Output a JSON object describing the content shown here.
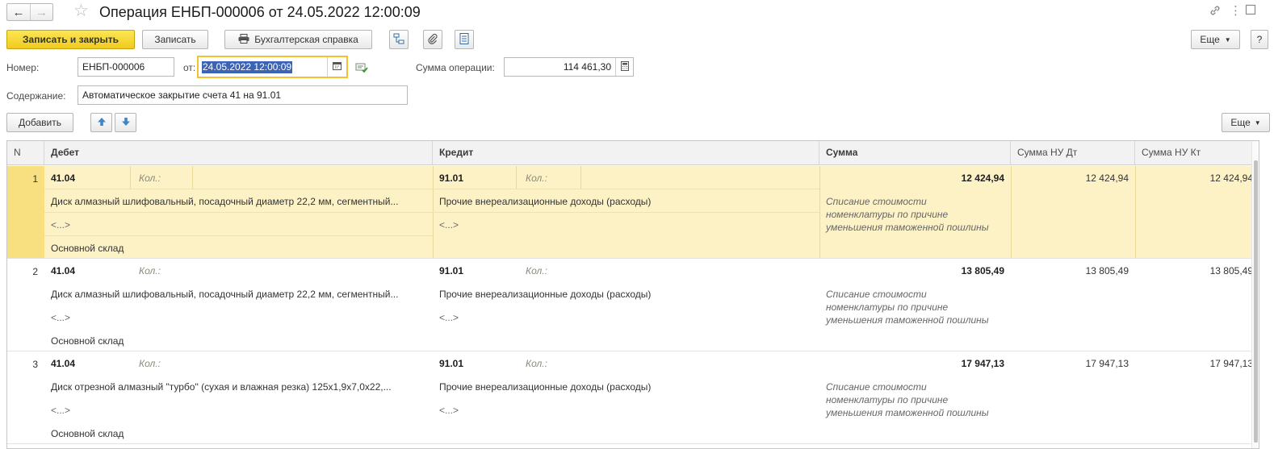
{
  "header": {
    "back_icon": "arrow-left-icon",
    "forward_icon": "arrow-right-icon",
    "title": "Операция ЕНБП-000006 от 24.05.2022 12:00:09",
    "help_label": "?"
  },
  "toolbar": {
    "save_close_label": "Записать и закрыть",
    "save_label": "Записать",
    "report_label": "Бухгалтерская справка",
    "more_label": "Еще"
  },
  "form": {
    "number_label": "Номер:",
    "number_value": "ЕНБП-000006",
    "date_label": "от:",
    "date_value": "24.05.2022 12:00:09",
    "sum_label": "Сумма операции:",
    "sum_value": "114 461,30",
    "content_label": "Содержание:",
    "content_value": "Автоматическое закрытие счета 41 на 91.01"
  },
  "table_toolbar": {
    "add_label": "Добавить",
    "more_label": "Еще"
  },
  "table": {
    "columns": [
      "N",
      "Дебет",
      "Кредит",
      "Сумма",
      "Сумма НУ Дт",
      "Сумма НУ Кт"
    ],
    "kol_label": "Кол.:",
    "rows": [
      {
        "n": "1",
        "debit_account": "41.04",
        "debit_item": "Диск алмазный шлифовальный, посадочный диаметр 22,2 мм, сегментный...",
        "debit_sub2": "<...>",
        "debit_sub3": "Основной склад",
        "credit_account": "91.01",
        "credit_item": "Прочие внереализационные доходы (расходы)",
        "credit_sub2": "<...>",
        "sum": "12 424,94",
        "comment_1": "Списание стоимости",
        "comment_2": "номенклатуры по причине",
        "comment_3": "уменьшения таможенной пошлины",
        "sum_nu_dt": "12 424,94",
        "sum_nu_kt": "12 424,94"
      },
      {
        "n": "2",
        "debit_account": "41.04",
        "debit_item": "Диск алмазный шлифовальный, посадочный диаметр 22,2 мм, сегментный...",
        "debit_sub2": "<...>",
        "debit_sub3": "Основной склад",
        "credit_account": "91.01",
        "credit_item": "Прочие внереализационные доходы (расходы)",
        "credit_sub2": "<...>",
        "sum": "13 805,49",
        "comment_1": "Списание стоимости",
        "comment_2": "номенклатуры по причине",
        "comment_3": "уменьшения таможенной пошлины",
        "sum_nu_dt": "13 805,49",
        "sum_nu_kt": "13 805,49"
      },
      {
        "n": "3",
        "debit_account": "41.04",
        "debit_item": "Диск отрезной алмазный \"турбо\" (сухая и влажная резка)  125х1,9х7,0х22,...",
        "debit_sub2": "<...>",
        "debit_sub3": "Основной склад",
        "credit_account": "91.01",
        "credit_item": "Прочие внереализационные доходы (расходы)",
        "credit_sub2": "<...>",
        "sum": "17 947,13",
        "comment_1": "Списание стоимости",
        "comment_2": "номенклатуры по причине",
        "comment_3": "уменьшения таможенной пошлины",
        "sum_nu_dt": "17 947,13",
        "sum_nu_kt": "17 947,13"
      }
    ]
  },
  "colors": {
    "primary_button": "#f4d43a",
    "selected_row": "#fcf2c6",
    "selected_row_number": "#f8df80",
    "date_focus_border": "#f2c230",
    "text_selection": "#3d63b5"
  }
}
